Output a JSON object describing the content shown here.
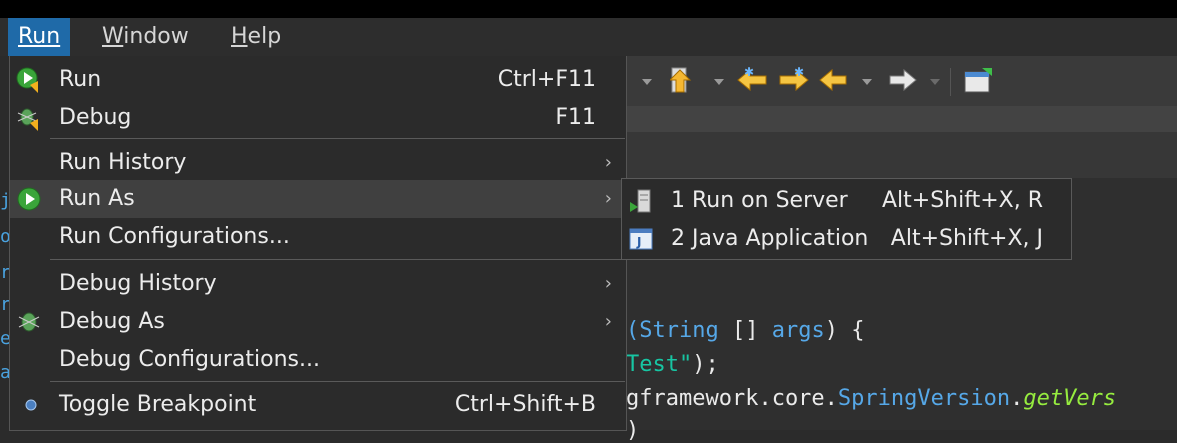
{
  "menubar": {
    "run": "Run",
    "window_rest": "indow",
    "window_u": "W",
    "help_u": "H",
    "help_rest": "elp"
  },
  "run_menu": {
    "items": [
      {
        "label": "Run",
        "accel": "Ctrl+F11"
      },
      {
        "label": "Debug",
        "accel": "F11"
      },
      {
        "label": "Run History",
        "arrow": "›"
      },
      {
        "label": "Run As",
        "arrow": "›"
      },
      {
        "label": "Run Configurations..."
      },
      {
        "label": "Debug History",
        "arrow": "›"
      },
      {
        "label": "Debug As",
        "arrow": "›"
      },
      {
        "label": "Debug Configurations..."
      },
      {
        "label": "Toggle Breakpoint",
        "accel": "Ctrl+Shift+B"
      }
    ]
  },
  "run_as_submenu": {
    "items": [
      {
        "label": "1 Run on Server",
        "accel": "Alt+Shift+X, R"
      },
      {
        "label": "2 Java Application",
        "accel": "Alt+Shift+X, J"
      }
    ]
  },
  "editor": {
    "l1_a": "(",
    "l1_type": "String",
    "l1_b": " [] ",
    "l1_args": "args",
    "l1_c": ") {",
    "l2_str": "Test\"",
    "l2_c": ");",
    "l3_a": "gframework.core.",
    "l3_cls": "SpringVersion",
    "l3_dot": ".",
    "l3_method": "getVers",
    "l4": ")"
  },
  "gutter": [
    "j",
    "o",
    "r",
    "r",
    "e",
    "a"
  ],
  "colors": {
    "menu_active": "#1f6aa8",
    "highlight": "#404040"
  }
}
